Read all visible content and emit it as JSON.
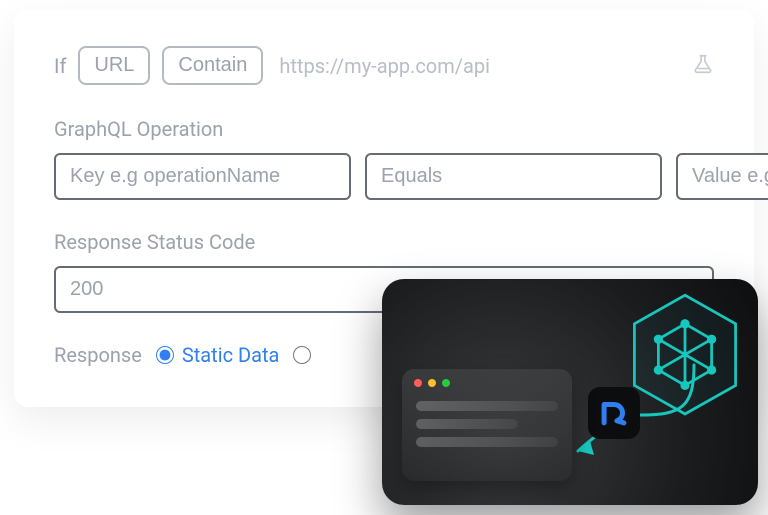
{
  "condition": {
    "if_label": "If",
    "field": "URL",
    "operator": "Contain",
    "value": "https://my-app.com/api"
  },
  "graphql": {
    "section_label": "GraphQL Operation",
    "key_placeholder": "Key e.g operationName",
    "operator": "Equals",
    "value_placeholder": "Value e.g. getUser"
  },
  "status": {
    "section_label": "Response Status Code",
    "value": "200"
  },
  "response": {
    "label": "Response",
    "static_data_label": "Static Data"
  },
  "colors": {
    "accent_blue": "#2f7ff2",
    "teal": "#17c7bd"
  }
}
